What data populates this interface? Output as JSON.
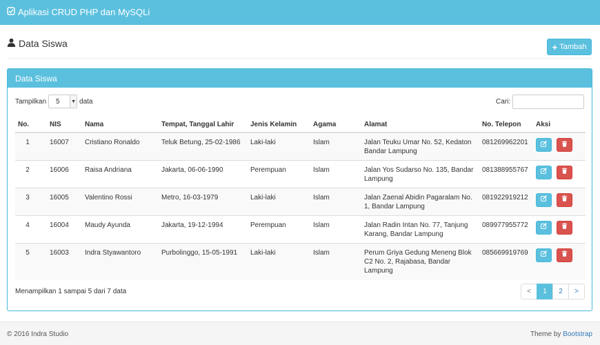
{
  "navbar": {
    "brand": "Aplikasi CRUD PHP dan MySQLi"
  },
  "page": {
    "title": "Data Siswa",
    "add_button": "Tambah"
  },
  "panel": {
    "heading": "Data Siswa",
    "show_label": "Tampilkan",
    "show_value": "5",
    "show_suffix": "data",
    "search_label": "Cari:",
    "search_value": ""
  },
  "table": {
    "headers": [
      "No.",
      "NIS",
      "Nama",
      "Tempat, Tanggal Lahir",
      "Jenis Kelamin",
      "Agama",
      "Alamat",
      "No. Telepon",
      "Aksi"
    ],
    "rows": [
      {
        "no": "1",
        "nis": "16007",
        "nama": "Cristiano Ronaldo",
        "ttl": "Teluk Betung, 25-02-1986",
        "jk": "Laki-laki",
        "agama": "Islam",
        "alamat": "Jalan Teuku Umar No. 52, Kedaton Bandar Lampung",
        "telp": "081269962201"
      },
      {
        "no": "2",
        "nis": "16006",
        "nama": "Raisa Andriana",
        "ttl": "Jakarta, 06-06-1990",
        "jk": "Perempuan",
        "agama": "Islam",
        "alamat": "Jalan Yos Sudarso No. 135, Bandar Lampung",
        "telp": "081388955767"
      },
      {
        "no": "3",
        "nis": "16005",
        "nama": "Valentino Rossi",
        "ttl": "Metro, 16-03-1979",
        "jk": "Laki-laki",
        "agama": "Islam",
        "alamat": "Jalan Zaenal Abidin Pagaralam No. 1, Bandar Lampung",
        "telp": "081922919212"
      },
      {
        "no": "4",
        "nis": "16004",
        "nama": "Maudy Ayunda",
        "ttl": "Jakarta, 19-12-1994",
        "jk": "Perempuan",
        "agama": "Islam",
        "alamat": "Jalan Radin Intan No. 77, Tanjung Karang, Bandar Lampung",
        "telp": "089977955772"
      },
      {
        "no": "5",
        "nis": "16003",
        "nama": "Indra Styawantoro",
        "ttl": "Purbolinggo, 15-05-1991",
        "jk": "Laki-laki",
        "agama": "Islam",
        "alamat": "Perum Griya Gedung Meneng Blok C2 No. 2, Rajabasa, Bandar Lampung",
        "telp": "085669919769"
      }
    ]
  },
  "summary": "Menampilkan 1 sampai 5 dari 7 data",
  "pagination": {
    "prev": "<",
    "pages": [
      "1",
      "2"
    ],
    "next": ">",
    "active": "1"
  },
  "footer": {
    "copyright": "© 2016 Indra Studio",
    "theme_prefix": "Theme by",
    "theme_link": "Bootstrap"
  },
  "colors": {
    "primary": "#5bc0de",
    "danger": "#d9534f",
    "link": "#337ab7"
  },
  "icons": {
    "brand": "check-square-icon",
    "title": "user-icon",
    "add": "plus-icon",
    "edit": "edit-icon",
    "delete": "trash-icon"
  }
}
